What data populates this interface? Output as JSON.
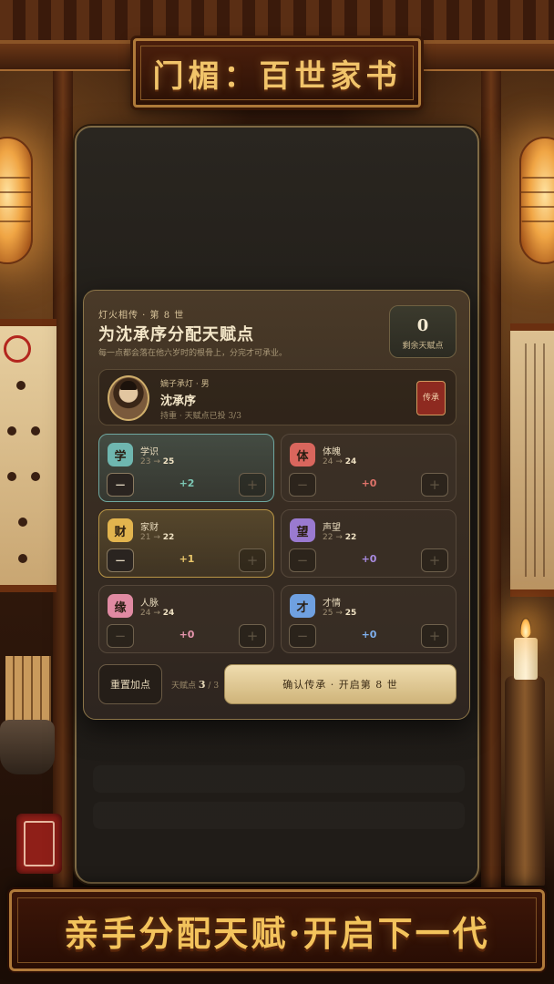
{
  "title_plaque": "门楣：百世家书",
  "banner": "亲手分配天赋·开启下一代",
  "card": {
    "eyebrow": "灯火相传 · 第 8 世",
    "headline": "为沈承序分配天赋点",
    "subline": "每一点都会落在他六岁时的根骨上，分完才可承业。",
    "points_remaining": "0",
    "points_label": "剩余天赋点"
  },
  "heir": {
    "tag": "嫡子承灯 · 男",
    "name": "沈承序",
    "status": "持重 · 天赋点已投 3/3",
    "seal": "传承"
  },
  "stats": [
    {
      "badge": "学",
      "name": "学识",
      "from": "23",
      "to": "25",
      "delta": "+2",
      "color": "#6fb7b0",
      "delta_color": "#7cc7b5"
    },
    {
      "badge": "体",
      "name": "体魄",
      "from": "24",
      "to": "24",
      "delta": "+0",
      "color": "#d9665d",
      "delta_color": "#e0736a"
    },
    {
      "badge": "财",
      "name": "家财",
      "from": "21",
      "to": "22",
      "delta": "+1",
      "color": "#e2b44e",
      "delta_color": "#e9c66a"
    },
    {
      "badge": "望",
      "name": "声望",
      "from": "22",
      "to": "22",
      "delta": "+0",
      "color": "#9a7ad0",
      "delta_color": "#a98be0"
    },
    {
      "badge": "缘",
      "name": "人脉",
      "from": "24",
      "to": "24",
      "delta": "+0",
      "color": "#e08aa2",
      "delta_color": "#e695ad"
    },
    {
      "badge": "才",
      "name": "才情",
      "from": "25",
      "to": "25",
      "delta": "+0",
      "color": "#6fa0e0",
      "delta_color": "#7fb0ee"
    }
  ],
  "footer": {
    "reset": "重置加点",
    "tally_label": "天赋点",
    "tally_used": "3",
    "tally_total": "3",
    "confirm": "确认传承 · 开启第 8 世"
  },
  "icons": {
    "arrow": "→",
    "minus": "−",
    "plus": "+"
  }
}
